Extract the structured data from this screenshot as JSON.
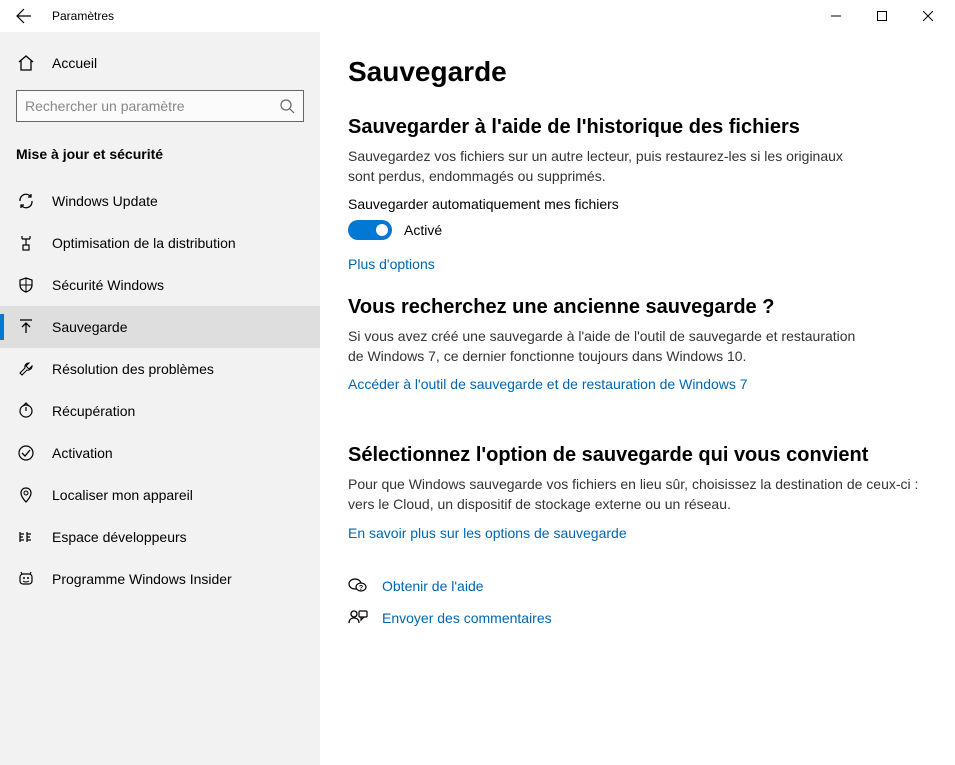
{
  "titlebar": {
    "title": "Paramètres"
  },
  "sidebar": {
    "home": "Accueil",
    "search_placeholder": "Rechercher un paramètre",
    "section": "Mise à jour et sécurité",
    "items": [
      {
        "label": "Windows Update"
      },
      {
        "label": "Optimisation de la distribution"
      },
      {
        "label": "Sécurité Windows"
      },
      {
        "label": "Sauvegarde"
      },
      {
        "label": "Résolution des problèmes"
      },
      {
        "label": "Récupération"
      },
      {
        "label": "Activation"
      },
      {
        "label": "Localiser mon appareil"
      },
      {
        "label": "Espace développeurs"
      },
      {
        "label": "Programme Windows Insider"
      }
    ]
  },
  "main": {
    "page_title": "Sauvegarde",
    "s1": {
      "heading": "Sauvegarder à l'aide de l'historique des fichiers",
      "desc": "Sauvegardez vos fichiers sur un autre lecteur, puis restaurez-les si les originaux sont perdus, endommagés ou supprimés.",
      "toggle_label": "Sauvegarder automatiquement mes fichiers",
      "toggle_state": "Activé",
      "more_options": "Plus d'options"
    },
    "s2": {
      "heading": "Vous recherchez une ancienne sauvegarde ?",
      "desc": "Si vous avez créé une sauvegarde à l'aide de l'outil de sauvegarde et restauration de Windows 7, ce dernier fonctionne toujours dans Windows 10.",
      "link": "Accéder à l'outil de sauvegarde et de restauration de Windows 7"
    },
    "s3": {
      "heading": "Sélectionnez l'option de sauvegarde qui vous convient",
      "desc": "Pour que Windows sauvegarde vos fichiers en lieu sûr, choisissez la destination de ceux-ci : vers le Cloud, un dispositif de stockage externe ou un réseau.",
      "link": "En savoir plus sur les options de sauvegarde"
    },
    "help": "Obtenir de l'aide",
    "feedback": "Envoyer des commentaires"
  }
}
